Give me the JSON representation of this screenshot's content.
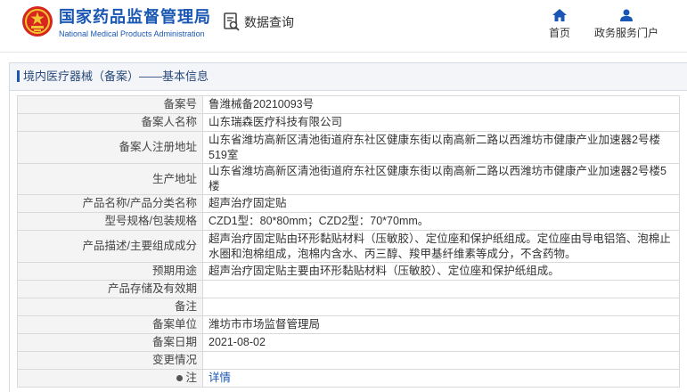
{
  "header": {
    "brand_cn": "国家药品监督管理局",
    "brand_en": "National Medical Products Administration",
    "query_label": "数据查询",
    "nav": {
      "home": "首页",
      "portal": "政务服务门户"
    },
    "colors": {
      "brand": "#1a57b4",
      "emblem_red": "#d7261e",
      "emblem_gold": "#f3c431"
    }
  },
  "panel": {
    "breadcrumb": "境内医疗器械（备案）——基本信息"
  },
  "details": [
    {
      "key": "备案号",
      "value": "鲁潍械备20210093号"
    },
    {
      "key": "备案人名称",
      "value": "山东瑞森医疗科技有限公司"
    },
    {
      "key": "备案人注册地址",
      "value": "山东省潍坊高新区清池街道府东社区健康东街以南高新二路以西潍坊市健康产业加速器2号楼519室"
    },
    {
      "key": "生产地址",
      "value": "山东省潍坊高新区清池街道府东社区健康东街以南高新二路以西潍坊市健康产业加速器2号楼5楼"
    },
    {
      "key": "产品名称/产品分类名称",
      "value": "超声治疗固定贴"
    },
    {
      "key": "型号规格/包装规格",
      "value": "CZD1型：80*80mm；CZD2型：70*70mm。"
    },
    {
      "key": "产品描述/主要组成成分",
      "value": "超声治疗固定贴由环形黏贴材料（压敏胶）、定位座和保护纸组成。定位座由导电铝箔、泡棉止水圈和泡棉组成，泡棉内含水、丙三醇、羧甲基纤维素等成分，不含药物。"
    },
    {
      "key": "预期用途",
      "value": "超声治疗固定贴主要由环形黏贴材料（压敏胶）、定位座和保护纸组成。"
    },
    {
      "key": "产品存储及有效期",
      "value": ""
    },
    {
      "key": "备注",
      "value": ""
    },
    {
      "key": "备案单位",
      "value": "潍坊市市场监督管理局"
    },
    {
      "key": "备案日期",
      "value": "2021-08-02"
    },
    {
      "key": "变更情况",
      "value": ""
    },
    {
      "key": "注",
      "value": "详情",
      "is_link": true
    }
  ]
}
